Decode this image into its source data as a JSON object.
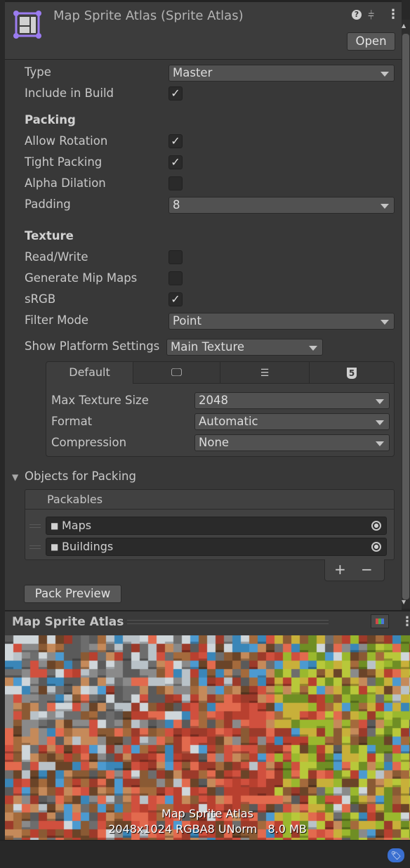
{
  "header": {
    "title": "Map Sprite Atlas (Sprite Atlas)",
    "open_label": "Open"
  },
  "fields": {
    "type": {
      "label": "Type",
      "value": "Master"
    },
    "include_in_build": {
      "label": "Include in Build",
      "checked": true
    },
    "packing_header": "Packing",
    "allow_rotation": {
      "label": "Allow Rotation",
      "checked": true
    },
    "tight_packing": {
      "label": "Tight Packing",
      "checked": true
    },
    "alpha_dilation": {
      "label": "Alpha Dilation",
      "checked": false
    },
    "padding": {
      "label": "Padding",
      "value": "8"
    },
    "texture_header": "Texture",
    "read_write": {
      "label": "Read/Write",
      "checked": false
    },
    "generate_mip_maps": {
      "label": "Generate Mip Maps",
      "checked": false
    },
    "srgb": {
      "label": "sRGB",
      "checked": true
    },
    "filter_mode": {
      "label": "Filter Mode",
      "value": "Point"
    },
    "show_platform_settings": {
      "label": "Show Platform Settings",
      "value": "Main Texture"
    }
  },
  "platform": {
    "tabs": [
      {
        "label": "Default",
        "icon": null
      },
      {
        "icon": "monitor-icon"
      },
      {
        "icon": "server-icon"
      },
      {
        "icon": "html5-icon"
      }
    ],
    "max_texture_size": {
      "label": "Max Texture Size",
      "value": "2048"
    },
    "format": {
      "label": "Format",
      "value": "Automatic"
    },
    "compression": {
      "label": "Compression",
      "value": "None"
    }
  },
  "objects": {
    "label": "Objects for Packing",
    "list_header": "Packables",
    "items": [
      {
        "name": "Maps"
      },
      {
        "name": "Buildings"
      }
    ],
    "add": "+",
    "remove": "−"
  },
  "pack_preview_label": "Pack Preview",
  "preview": {
    "title": "Map Sprite Atlas",
    "name": "Map Sprite Atlas",
    "info": "2048x1024 RGBA8 UNorm   8.0 MB"
  },
  "colors": {
    "accent": "#9b7cf0",
    "panel": "#383838"
  }
}
